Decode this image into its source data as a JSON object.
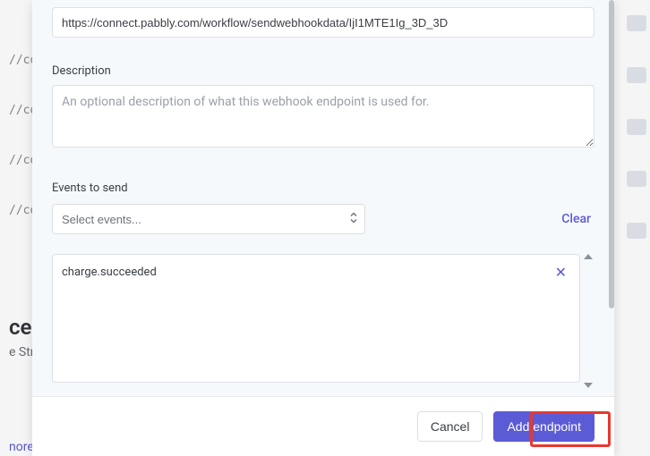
{
  "backdrop": {
    "code_rows": [
      "//co",
      "//co",
      "//co",
      "//co"
    ],
    "heading": "ces",
    "sub": "e Strip",
    "link": "nore"
  },
  "form": {
    "url_value": "https://connect.pabbly.com/workflow/sendwebhookdata/IjI1MTE1Ig_3D_3D",
    "description_label": "Description",
    "description_placeholder": "An optional description of what this webhook endpoint is used for.",
    "events_label": "Events to send",
    "select_placeholder": "Select events...",
    "clear_label": "Clear"
  },
  "events": [
    {
      "name": "charge.succeeded"
    }
  ],
  "footer": {
    "cancel": "Cancel",
    "submit": "Add endpoint"
  },
  "rightbar_chip_tops": [
    17,
    75,
    133,
    191,
    249
  ]
}
